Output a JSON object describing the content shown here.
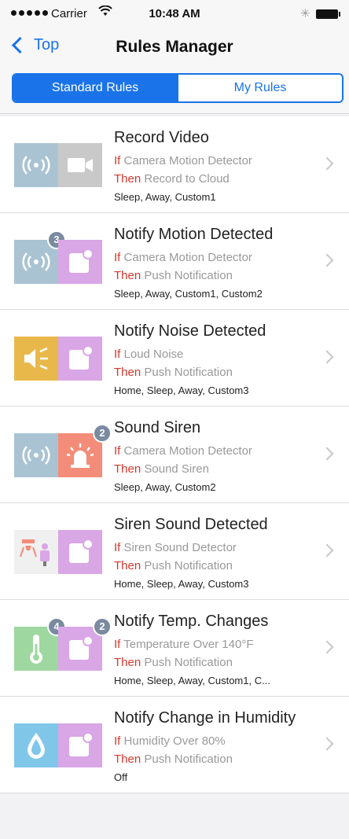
{
  "status_bar": {
    "carrier": "Carrier",
    "time": "10:48 AM"
  },
  "nav": {
    "back_label": "Top",
    "title": "Rules Manager"
  },
  "segmented": {
    "tabs": [
      "Standard Rules",
      "My Rules"
    ],
    "selected": "Standard Rules"
  },
  "if_word": "If",
  "then_word": "Then",
  "rules": [
    {
      "title": "Record Video",
      "if_text": "Camera Motion Detector",
      "then_text": "Record to Cloud",
      "modes": "Sleep, Away, Custom1",
      "left_icon": "motion-sensor-icon",
      "right_icon": "video-camera-icon",
      "left_badge": "",
      "right_badge": ""
    },
    {
      "title": "Notify Motion Detected",
      "if_text": "Camera Motion Detector",
      "then_text": "Push Notification",
      "modes": "Sleep, Away, Custom1, Custom2",
      "left_icon": "motion-sensor-icon",
      "right_icon": "notification-icon",
      "left_badge": "3",
      "right_badge": ""
    },
    {
      "title": "Notify Noise Detected",
      "if_text": "Loud Noise",
      "then_text": "Push Notification",
      "modes": "Home, Sleep, Away, Custom3",
      "left_icon": "loud-noise-icon",
      "right_icon": "notification-icon",
      "left_badge": "",
      "right_badge": ""
    },
    {
      "title": "Sound Siren",
      "if_text": "Camera Motion Detector",
      "then_text": "Sound Siren",
      "modes": "Sleep, Away, Custom2",
      "left_icon": "motion-sensor-icon",
      "right_icon": "siren-icon",
      "left_badge": "",
      "right_badge": "2"
    },
    {
      "title": "Siren Sound Detected",
      "if_text": "Siren Sound Detector",
      "then_text": "Push Notification",
      "modes": "Home, Sleep, Away, Custom3",
      "left_icon": "siren-detector-icon",
      "right_icon": "notification-icon",
      "left_badge": "",
      "right_badge": ""
    },
    {
      "title": "Notify Temp. Changes",
      "if_text": "Temperature Over 140°F",
      "then_text": "Push Notification",
      "modes": "Home, Sleep, Away, Custom1, C...",
      "left_icon": "thermometer-icon",
      "right_icon": "notification-icon",
      "left_badge": "4",
      "right_badge": "2"
    },
    {
      "title": "Notify Change in Humidity",
      "if_text": "Humidity Over 80%",
      "then_text": "Push Notification",
      "modes": "Off",
      "left_icon": "humidity-drop-icon",
      "right_icon": "notification-icon",
      "left_badge": "",
      "right_badge": ""
    }
  ],
  "colors": {
    "accent": "#1a73e8",
    "keyword": "#d2382d"
  }
}
